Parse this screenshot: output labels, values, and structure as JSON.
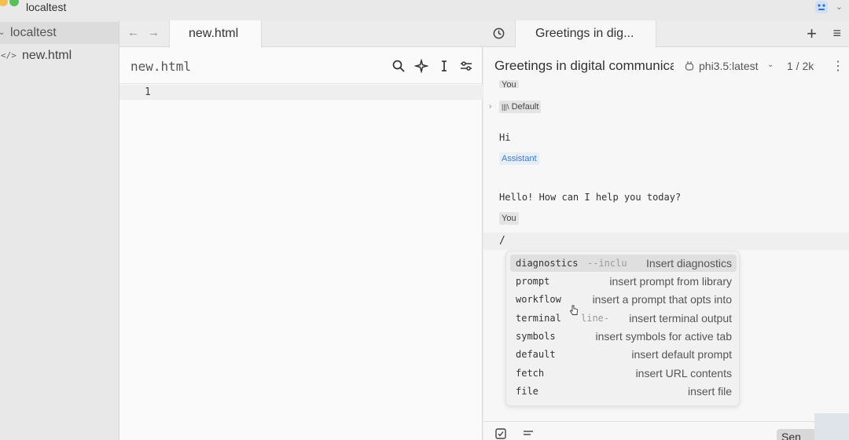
{
  "window": {
    "title": "localtest"
  },
  "sidebar": {
    "root": "localtest",
    "files": [
      {
        "name": "new.html",
        "icon": "code-icon"
      }
    ]
  },
  "editor": {
    "tab_label": "new.html",
    "filename": "new.html",
    "line_numbers": [
      "1"
    ],
    "tools": [
      "search-icon",
      "sparkle-icon",
      "text-cursor-icon",
      "sliders-icon"
    ]
  },
  "chat": {
    "tab_label": "Greetings in dig...",
    "title": "Greetings in digital communica",
    "model": "phi3.5:latest",
    "tokens": "1 / 2k",
    "messages": {
      "you_top": "You",
      "default_label": "Default",
      "user_text": "Hi",
      "assistant_label": "Assistant",
      "assistant_text": "Hello! How can I help you today?",
      "you_label": "You",
      "input_text": "/"
    },
    "commands": [
      {
        "cmd": "diagnostics",
        "hint": "--inclu",
        "desc": "Insert diagnostics"
      },
      {
        "cmd": "prompt",
        "hint": "",
        "desc": "insert prompt from library"
      },
      {
        "cmd": "workflow",
        "hint": "",
        "desc": "insert a prompt that opts into"
      },
      {
        "cmd": "terminal",
        "hint": "line-",
        "desc": "insert terminal output"
      },
      {
        "cmd": "symbols",
        "hint": "",
        "desc": "insert symbols for active tab"
      },
      {
        "cmd": "default",
        "hint": "",
        "desc": "insert default prompt"
      },
      {
        "cmd": "fetch",
        "hint": "",
        "desc": "insert URL contents"
      },
      {
        "cmd": "file",
        "hint": "",
        "desc": "insert file"
      }
    ],
    "send_label": "Sen"
  }
}
